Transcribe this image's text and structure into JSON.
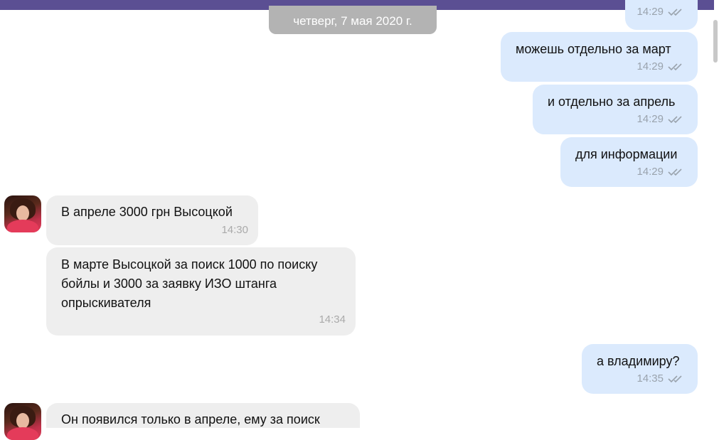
{
  "date_separator": "четверг, 7 мая 2020 г.",
  "messages": [
    {
      "dir": "out",
      "text": "",
      "time": "14:29"
    },
    {
      "dir": "out",
      "text": "можешь отдельно за март",
      "time": "14:29"
    },
    {
      "dir": "out",
      "text": "и отдельно за апрель",
      "time": "14:29"
    },
    {
      "dir": "out",
      "text": "для информации",
      "time": "14:29"
    },
    {
      "dir": "in",
      "text": "В апреле 3000 грн Высоцкой",
      "time": "14:30"
    },
    {
      "dir": "in",
      "lines": [
        "В марте Высоцкой за поиск 1000 по поиску",
        "бойлы и 3000 за заявку ИЗО штанга",
        "опрыскивателя"
      ],
      "time": "14:34"
    },
    {
      "dir": "out",
      "text": "а владимиру?",
      "time": "14:35"
    },
    {
      "dir": "in",
      "text": "Он появился только в апреле, ему за поиск",
      "time": ""
    }
  ],
  "icons": {
    "read_receipt": "double-check-icon",
    "avatar": "contact-avatar"
  },
  "colors": {
    "topbar": "#5b4f93",
    "outgoing": "#dbeafd",
    "incoming": "#eeeeee",
    "pill": "#b3b3b3"
  }
}
